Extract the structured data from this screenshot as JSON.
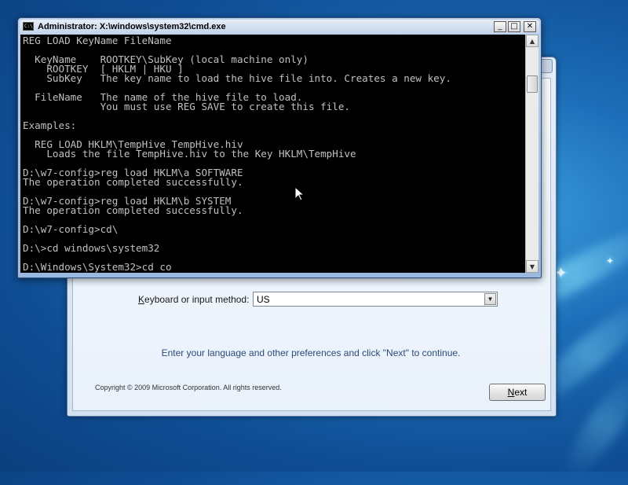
{
  "cmd_window": {
    "title": "Administrator: X:\\windows\\system32\\cmd.exe",
    "icon_text": "C:\\",
    "buttons": {
      "minimize": "_",
      "maximize": "□",
      "close": "✕"
    },
    "console_lines": [
      "REG LOAD KeyName FileName",
      "",
      "  KeyName    ROOTKEY\\SubKey (local machine only)",
      "    ROOTKEY  [ HKLM | HKU ]",
      "    SubKey   The key name to load the hive file into. Creates a new key.",
      "",
      "  FileName   The name of the hive file to load.",
      "             You must use REG SAVE to create this file.",
      "",
      "Examples:",
      "",
      "  REG LOAD HKLM\\TempHive TempHive.hiv",
      "    Loads the file TempHive.hiv to the Key HKLM\\TempHive",
      "",
      "D:\\w7-config>reg load HKLM\\a SOFTWARE",
      "The operation completed successfully.",
      "",
      "D:\\w7-config>reg load HKLM\\b SYSTEM",
      "The operation completed successfully.",
      "",
      "D:\\w7-config>cd\\",
      "",
      "D:\\>cd windows\\system32",
      "",
      "D:\\Windows\\System32>cd co"
    ],
    "scroll_up_icon": "▲",
    "scroll_down_icon": "▼"
  },
  "setup_window": {
    "keyboard_label_accel": "K",
    "keyboard_label_rest": "eyboard or input method:",
    "keyboard_value": "US",
    "dropdown_arrow": "▼",
    "instruction": "Enter your language and other preferences and click \"Next\" to continue.",
    "copyright": "Copyright © 2009 Microsoft Corporation. All rights reserved.",
    "next_accel": "N",
    "next_rest": "ext"
  },
  "desktop": {
    "sparkle_glyph": "✦"
  }
}
